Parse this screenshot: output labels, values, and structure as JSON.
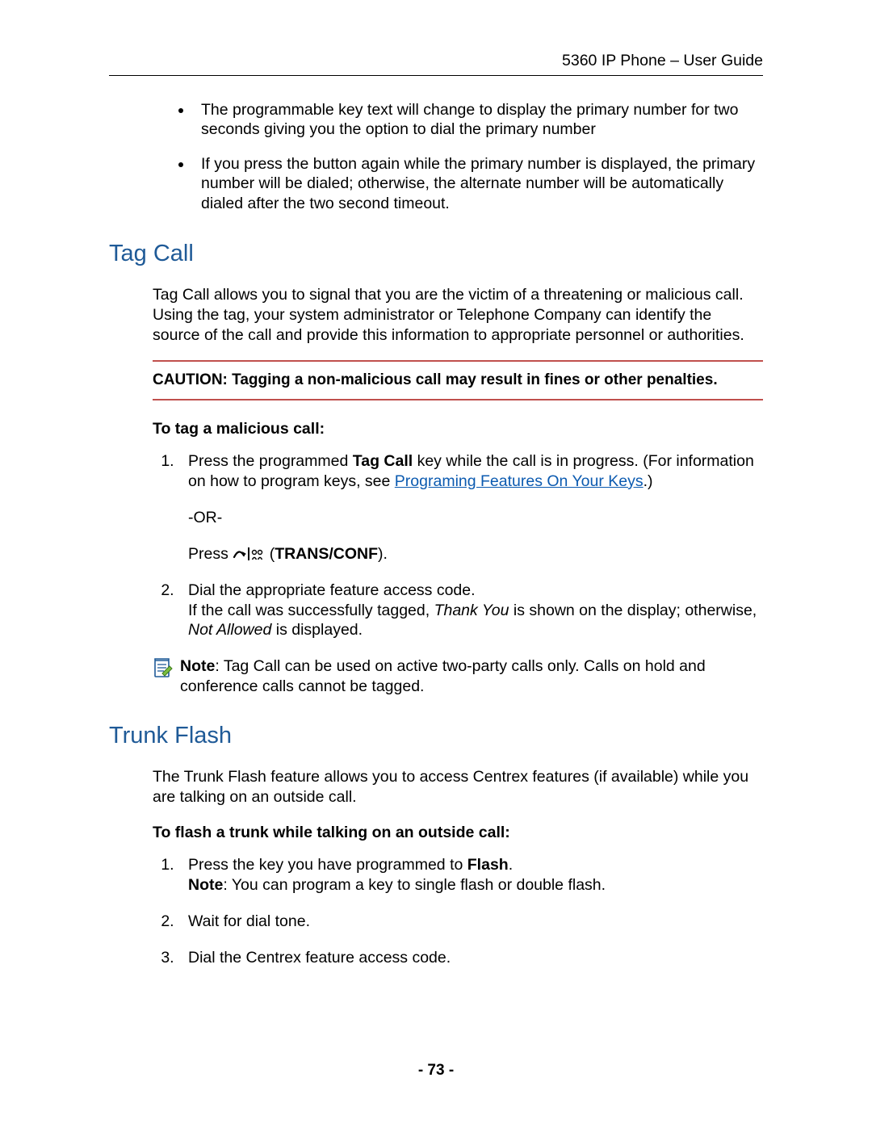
{
  "header": {
    "title": "5360 IP Phone – User Guide"
  },
  "intro_bullets": [
    "The programmable key text will change to display the primary number for two seconds giving you the option to dial the primary number",
    "If you press the button again while the primary number is displayed, the primary number will be dialed; otherwise, the alternate number will be automatically dialed after the two second timeout."
  ],
  "tag_call": {
    "heading": "Tag Call",
    "intro": "Tag Call allows you to signal that you are the victim of a threatening or malicious call. Using the tag, your system administrator or Telephone Company can identify the source of the call and provide this information to appropriate personnel or authorities.",
    "caution": "CAUTION: Tagging a non-malicious call may result in fines or other penalties.",
    "subhead": "To tag a malicious call:",
    "step1_prefix": "Press the programmed ",
    "step1_bold": "Tag Call",
    "step1_mid": " key while the call is in progress. (For information on how to program keys, see ",
    "step1_link": "Programing Features On Your Keys",
    "step1_suffix": ".)",
    "or_text": "-OR-",
    "press_text": "Press ",
    "trans_conf_open": " (",
    "trans_conf_bold": "TRANS/CONF",
    "trans_conf_close": ").",
    "step2_line1": "Dial the appropriate feature access code.",
    "step2_line2a": "If the call was successfully tagged, ",
    "step2_italic1": "Thank You",
    "step2_line2b": " is shown on the display; otherwise, ",
    "step2_italic2": "Not Allowed",
    "step2_line2c": " is displayed.",
    "note_bold": "Note",
    "note_text": ": Tag Call can be used on active two-party calls only. Calls on hold and conference calls cannot be tagged."
  },
  "trunk_flash": {
    "heading": "Trunk Flash",
    "intro": "The Trunk Flash feature allows you to access Centrex features (if available) while you are talking on an outside call.",
    "subhead": "To flash a trunk while talking on an outside call:",
    "step1_a": "Press the key you have programmed to ",
    "step1_bold": "Flash",
    "step1_b": ".",
    "step1_note_bold": "Note",
    "step1_note": ": You can program a key to single flash or double flash.",
    "step2": "Wait for dial tone.",
    "step3": "Dial the Centrex feature access code."
  },
  "footer": {
    "page_number": "- 73 -"
  }
}
